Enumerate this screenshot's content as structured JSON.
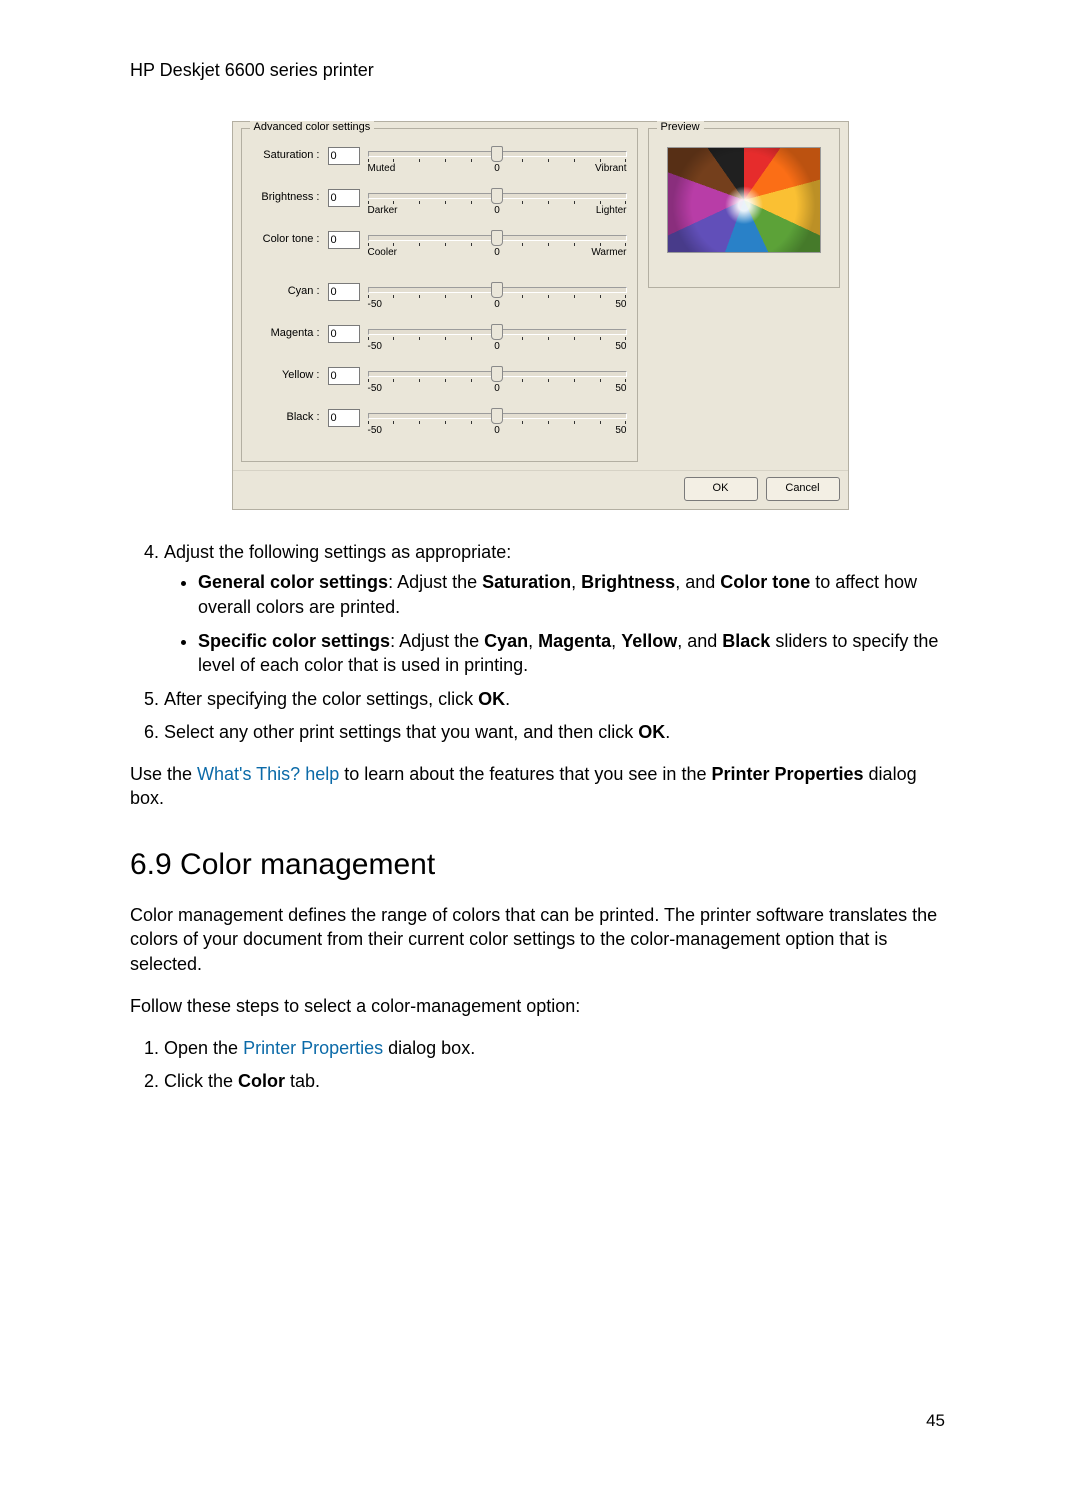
{
  "header": "HP Deskjet 6600 series printer",
  "dialog": {
    "advanced_title": "Advanced color settings",
    "preview_title": "Preview",
    "sliders_general": [
      {
        "label": "Saturation :",
        "value": "0",
        "left": "Muted",
        "center": "0",
        "right": "Vibrant"
      },
      {
        "label": "Brightness :",
        "value": "0",
        "left": "Darker",
        "center": "0",
        "right": "Lighter"
      },
      {
        "label": "Color tone :",
        "value": "0",
        "left": "Cooler",
        "center": "0",
        "right": "Warmer"
      }
    ],
    "sliders_color": [
      {
        "label": "Cyan :",
        "value": "0",
        "left": "-50",
        "center": "0",
        "right": "50"
      },
      {
        "label": "Magenta :",
        "value": "0",
        "left": "-50",
        "center": "0",
        "right": "50"
      },
      {
        "label": "Yellow :",
        "value": "0",
        "left": "-50",
        "center": "0",
        "right": "50"
      },
      {
        "label": "Black :",
        "value": "0",
        "left": "-50",
        "center": "0",
        "right": "50"
      }
    ],
    "ok": "OK",
    "cancel": "Cancel"
  },
  "step4_intro": "Adjust the following settings as appropriate:",
  "bullet1": {
    "b1": "General color settings",
    "t1": ": Adjust the ",
    "b2": "Saturation",
    "t2": ", ",
    "b3": "Brightness",
    "t3": ", and ",
    "b4": "Color tone",
    "t4": " to affect how overall colors are printed."
  },
  "bullet2": {
    "b1": "Specific color settings",
    "t1": ": Adjust the ",
    "b2": "Cyan",
    "t2": ", ",
    "b3": "Magenta",
    "t3": ", ",
    "b4": "Yellow",
    "t4": ", and ",
    "b5": "Black",
    "t5": " sliders to specify the level of each color that is used in printing."
  },
  "step5": {
    "t1": "After specifying the color settings, click ",
    "b1": "OK",
    "t2": "."
  },
  "step6": {
    "t1": "Select any other print settings that you want, and then click ",
    "b1": "OK",
    "t2": "."
  },
  "para_use": {
    "t1": "Use the ",
    "link": "What's This? help",
    "t2": " to learn about the features that you see in the ",
    "b1": "Printer Properties",
    "t3": " dialog box."
  },
  "section_title": "6.9  Color management",
  "para_cm1": "Color management defines the range of colors that can be printed. The printer software translates the colors of your document from their current color settings to the color-management option that is selected.",
  "para_cm2": "Follow these steps to select a color-management option:",
  "cm_step1": {
    "t1": "Open the ",
    "link": "Printer Properties",
    "t2": " dialog box."
  },
  "cm_step2": {
    "t1": "Click the ",
    "b1": "Color",
    "t2": " tab."
  },
  "page_number": "45"
}
